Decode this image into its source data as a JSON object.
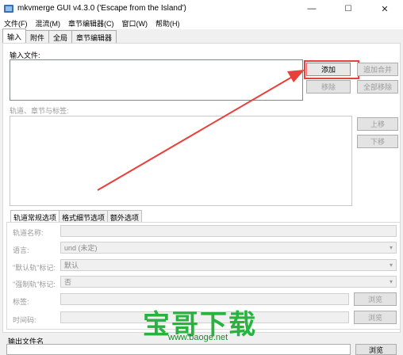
{
  "window": {
    "title": "mkvmerge GUI v4.3.0 ('Escape from the Island')",
    "minimize": "—",
    "maximize": "☐",
    "close": "✕"
  },
  "menu": [
    "文件(F)",
    "混流(M)",
    "章节编辑器(C)",
    "窗口(W)",
    "帮助(H)"
  ],
  "tabs": [
    "输入",
    "附件",
    "全局",
    "章节编辑器"
  ],
  "input": {
    "files_label": "输入文件:",
    "add_button": "添加",
    "append_button": "追加合并",
    "remove_button": "移除",
    "remove_all_button": "全部移除",
    "tracks_label": "轨道、章节与标签:",
    "up_button": "上移",
    "down_button": "下移"
  },
  "subtabs": [
    "轨道常规选项",
    "格式细节选项",
    "额外选项"
  ],
  "track_opts": {
    "track_name_label": "轨道名称:",
    "language_label": "语言:",
    "language_value": "und (未定)",
    "default_label": "\"默认轨\"标记:",
    "default_value": "默认",
    "forced_label": "\"强制轨\"标记:",
    "forced_value": "否",
    "tags_label": "标签:",
    "tags_browse": "浏览",
    "timecodes_label": "时间码:",
    "timecodes_browse": "浏览"
  },
  "output": {
    "label": "输出文件名",
    "browse": "浏览"
  },
  "watermark": {
    "text": "宝哥下载",
    "url": "www.baoge.net"
  },
  "colors": {
    "annotation": "#e8403a",
    "watermark": "#28b240"
  }
}
